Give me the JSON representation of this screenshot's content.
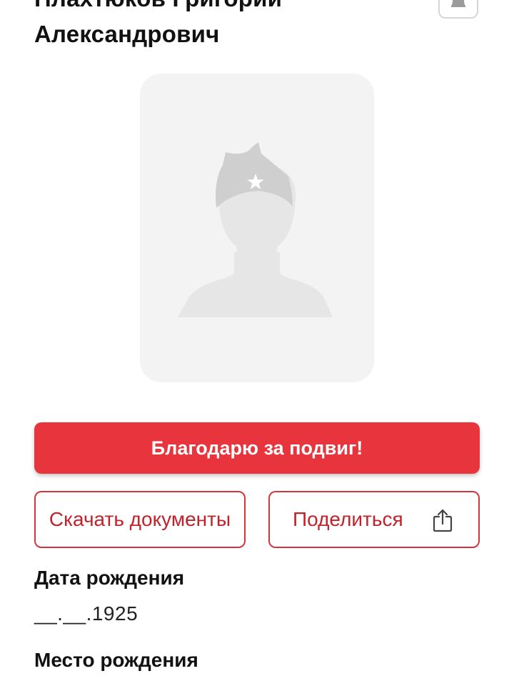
{
  "person": {
    "name_line1": "Плахтюков Григорий",
    "name_line2": "Александрович"
  },
  "header": {
    "bell_icon": "bell-icon"
  },
  "photo": {
    "placeholder_icon": "soldier-silhouette-icon"
  },
  "actions": {
    "thanks_label": "Благодарю за подвиг!",
    "download_label": "Скачать документы",
    "share_label": "Поделиться",
    "share_icon": "share-icon"
  },
  "details": {
    "birth_date_label": "Дата рождения",
    "birth_date_value": "__.__.1925",
    "birth_place_label": "Место рождения"
  },
  "colors": {
    "accent_red": "#e8343c",
    "outline_red": "#d6343b",
    "text_red": "#c3222b",
    "photo_bg": "#f3f3f3",
    "silhouette": "#e3e3e3"
  }
}
